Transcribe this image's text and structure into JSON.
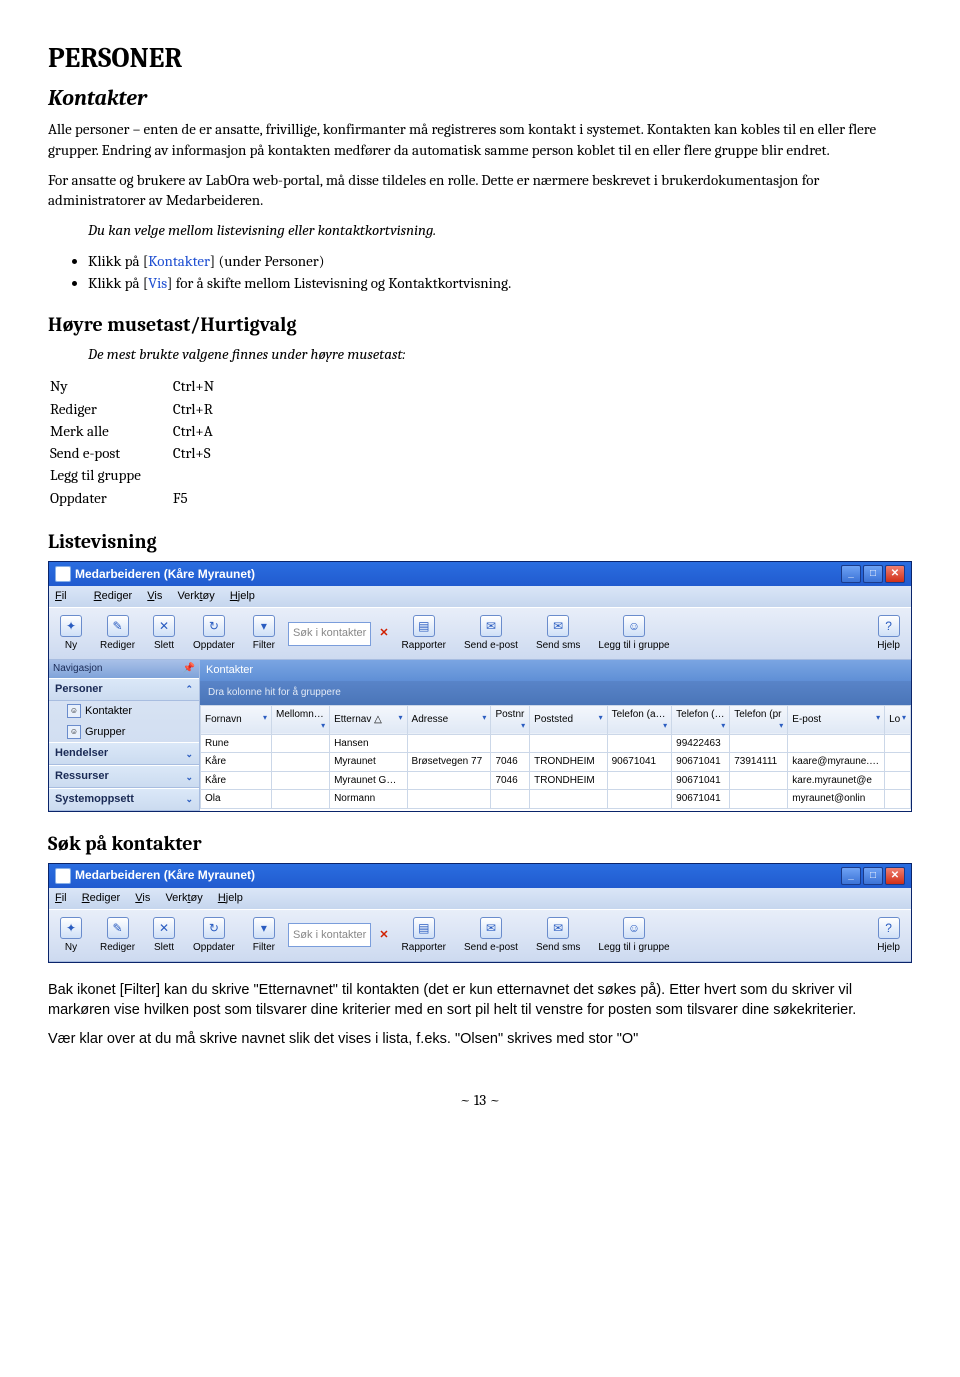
{
  "h1": "PERSONER",
  "h2_kontakter": "Kontakter",
  "p_kontakter_1": "Alle personer – enten de er ansatte, frivillige, konfirmanter må registreres som kontakt i systemet. Kontakten kan kobles til en eller flere grupper. Endring av informasjon på kontakten medfører da automatisk samme person koblet til en eller flere gruppe blir endret.",
  "p_kontakter_2": "For ansatte og brukere av LabOra web-portal, må disse tildeles en rolle. Dette er nærmere beskrevet i brukerdokumentasjon for administratorer av Medarbeideren.",
  "p_ital_1": "Du kan velge mellom listevisning eller kontaktkortvisning.",
  "bullet1_a": "Klikk på [",
  "bullet1_b": "Kontakter",
  "bullet1_c": "] (under Personer)",
  "bullet2_a": "Klikk på [",
  "bullet2_b": "Vis",
  "bullet2_c": "] for å skifte mellom Listevisning og Kontaktkortvisning.",
  "h3_hurtigvalg": "Høyre musetast/Hurtigvalg",
  "p_ital_2": "De mest brukte valgene finnes under høyre musetast:",
  "shortcuts": [
    {
      "name": "Ny",
      "key": "Ctrl+N"
    },
    {
      "name": "Rediger",
      "key": "Ctrl+R"
    },
    {
      "name": "Merk alle",
      "key": "Ctrl+A"
    },
    {
      "name": "Send e-post",
      "key": "Ctrl+S"
    },
    {
      "name": "Legg til gruppe",
      "key": ""
    },
    {
      "name": "Oppdater",
      "key": "F5"
    }
  ],
  "h3_listevisning": "Listevisning",
  "app": {
    "title": "Medarbeideren (Kåre Myraunet)",
    "menu": {
      "fil": "Fil",
      "rediger": "Rediger",
      "vis": "Vis",
      "verktoy": "Verktøy",
      "hjelp": "Hjelp"
    },
    "toolbar": {
      "ny": "Ny",
      "rediger": "Rediger",
      "slett": "Slett",
      "oppdater": "Oppdater",
      "filter": "Filter",
      "search_ph": "Søk i kontakter",
      "rapporter": "Rapporter",
      "sendepost": "Send e-post",
      "sendsms": "Send sms",
      "legg": "Legg til i gruppe",
      "hjelp": "Hjelp"
    },
    "nav": {
      "hdr": "Navigasjon",
      "pinned": "⌂",
      "personer": "Personer",
      "kontakter": "Kontakter",
      "grupper": "Grupper",
      "hendelser": "Hendelser",
      "ressurser": "Ressurser",
      "systemoppsett": "Systemoppsett"
    },
    "main": {
      "hdr": "Kontakter",
      "grp": "Dra kolonne hit for å gruppere",
      "cols": [
        "Fornavn",
        "Mellomn…",
        "Etternav △",
        "Adresse",
        "Postnr",
        "Poststed",
        "Telefon (arb)",
        "Telefon (…",
        "Telefon (pr",
        "E-post",
        "Lo"
      ],
      "rows": [
        {
          "fornavn": "Rune",
          "mellom": "",
          "etter": "Hansen",
          "adr": "",
          "postnr": "",
          "sted": "",
          "tarb": "",
          "tmob": "99422463",
          "tpriv": "",
          "epost": ""
        },
        {
          "fornavn": "Kåre",
          "mellom": "",
          "etter": "Myraunet",
          "adr": "Brøsetvegen 77",
          "postnr": "7046",
          "sted": "TRONDHEIM",
          "tarb": "90671041",
          "tmob": "90671041",
          "tpriv": "73914111",
          "epost": "kaare@myraune.No"
        },
        {
          "fornavn": "Kåre",
          "mellom": "",
          "etter": "Myraunet Gmail",
          "adr": "",
          "postnr": "7046",
          "sted": "TRONDHEIM",
          "tarb": "",
          "tmob": "90671041",
          "tpriv": "",
          "epost": "kare.myraunet@e"
        },
        {
          "fornavn": "Ola",
          "mellom": "",
          "etter": "Normann",
          "adr": "",
          "postnr": "",
          "sted": "",
          "tarb": "",
          "tmob": "90671041",
          "tpriv": "",
          "epost": "myraunet@onlin"
        }
      ]
    }
  },
  "h3_sok": "Søk på kontakter",
  "p_sok_1": "Bak ikonet [Filter] kan du skrive \"Etternavnet\" til kontakten (det er kun etternavnet det søkes på). Etter hvert som du skriver vil markøren vise hvilken post som tilsvarer dine kriterier med en sort pil helt til venstre for posten som tilsvarer dine søkekriterier.",
  "p_sok_2": "Vær klar over at du må skrive navnet slik det vises i lista, f.eks. \"Olsen\" skrives med stor \"O\"",
  "pagenum": "~ 13 ~"
}
